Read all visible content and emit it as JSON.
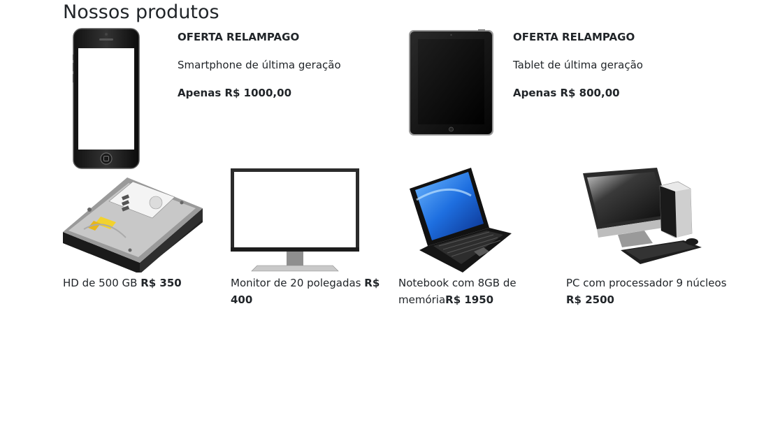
{
  "page": {
    "title": "Nossos produtos"
  },
  "featured": [
    {
      "headline": "OFERTA RELAMPAGO",
      "description": "Smartphone de última geração",
      "price_text": "Apenas R$ 1000,00",
      "icon": "smartphone-icon"
    },
    {
      "headline": "OFERTA RELAMPAGO",
      "description": "Tablet de última geração",
      "price_text": "Apenas R$ 800,00",
      "icon": "tablet-icon"
    }
  ],
  "products": [
    {
      "name": "HD de 500 GB ",
      "price": "R$ 350",
      "icon": "hard-drive-icon"
    },
    {
      "name": "Monitor de 20 polegadas ",
      "price": "R$ 400",
      "icon": "monitor-icon"
    },
    {
      "name": "Notebook com 8GB de memória",
      "price": "R$ 1950",
      "icon": "laptop-icon"
    },
    {
      "name": "PC com processador 9 núcleos ",
      "price": "R$ 2500",
      "icon": "desktop-pc-icon"
    }
  ]
}
